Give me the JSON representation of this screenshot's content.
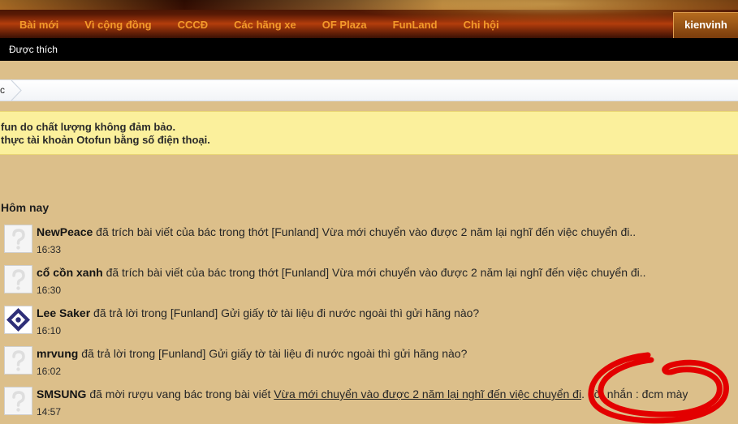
{
  "nav": {
    "items": [
      "Bài mới",
      "Vì cộng đồng",
      "CCCĐ",
      "Các hãng xe",
      "OF Plaza",
      "FunLand",
      "Chi hội"
    ],
    "user": "kienvinh"
  },
  "subnav": {
    "item": "Được thích"
  },
  "breadcrumb": {
    "text": "c"
  },
  "notice": {
    "line1": "fun do chất lượng không đảm bảo.",
    "line2": "thực tài khoản Otofun bằng số điện thoại."
  },
  "alerts": {
    "section_title": "Hôm nay",
    "items": [
      {
        "user": "NewPeace",
        "action": " đã trích bài viết của bác trong thớt [Funland] Vừa mới chuyển vào được 2 năm lại nghĩ đến việc chuyển đi..",
        "time": "16:33",
        "avatar": "default-avatar"
      },
      {
        "user": "cổ cồn xanh",
        "action": " đã trích bài viết của bác trong thớt [Funland] Vừa mới chuyển vào được 2 năm lại nghĩ đến việc chuyển đi..",
        "time": "16:30",
        "avatar": "default-avatar"
      },
      {
        "user": "Lee Saker",
        "action": " đã trả lời trong [Funland] Gửi giấy tờ tài liệu đi nước ngoài thì gửi hãng nào?",
        "time": "16:10",
        "avatar": "custom-avatar"
      },
      {
        "user": "mrvung",
        "action": " đã trả lời trong [Funland] Gửi giấy tờ tài liệu đi nước ngoài thì gửi hãng nào?",
        "time": "16:02",
        "avatar": "default-avatar"
      },
      {
        "user": "SMSUNG",
        "action": " đã mời rượu vang bác trong bài viết ",
        "link": "Vừa mới chuyển vào được 2 năm lại nghĩ đến việc chuyển đi",
        "suffix": ". Lời nhắn : đcm mày",
        "time": "14:57",
        "avatar": "default-avatar"
      }
    ]
  },
  "colors": {
    "page_bg": "#dcbf8a",
    "nav_text": "#f39a2b",
    "notice_bg": "#fbf09c",
    "annotation": "#e30000"
  }
}
